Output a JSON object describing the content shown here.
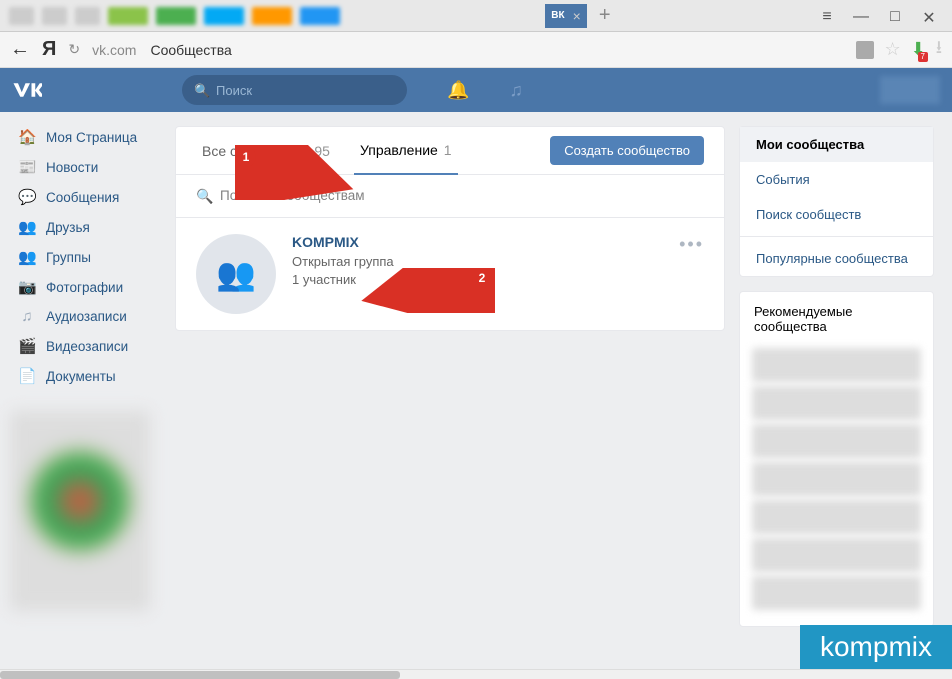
{
  "browser": {
    "url_host": "vk.com",
    "url_page": "Сообщества",
    "tab_label": "ВК",
    "dl_count": "7"
  },
  "header": {
    "search_placeholder": "Поиск"
  },
  "nav": {
    "items": [
      {
        "icon": "🏠",
        "label": "Моя Страница"
      },
      {
        "icon": "📰",
        "label": "Новости"
      },
      {
        "icon": "💬",
        "label": "Сообщения"
      },
      {
        "icon": "👥",
        "label": "Друзья"
      },
      {
        "icon": "👥",
        "label": "Группы"
      },
      {
        "icon": "📷",
        "label": "Фотографии"
      },
      {
        "icon": "♫",
        "label": "Аудиозаписи"
      },
      {
        "icon": "🎬",
        "label": "Видеозаписи"
      },
      {
        "icon": "📄",
        "label": "Документы"
      }
    ]
  },
  "tabs": {
    "all_label": "Все сообщества",
    "all_count": "95",
    "manage_label": "Управление",
    "manage_count": "1",
    "create_label": "Создать сообщество"
  },
  "filter": {
    "placeholder": "Поиск по сообществам"
  },
  "group": {
    "name": "KOMPMIX",
    "type": "Открытая группа",
    "members": "1 участник"
  },
  "sidebar": {
    "my_communities": "Мои сообщества",
    "events": "События",
    "search": "Поиск сообществ",
    "popular": "Популярные сообщества",
    "recommended": "Рекомендуемые сообщества"
  },
  "annotations": {
    "badge1": "1",
    "badge2": "2"
  },
  "watermark": "kompmix"
}
